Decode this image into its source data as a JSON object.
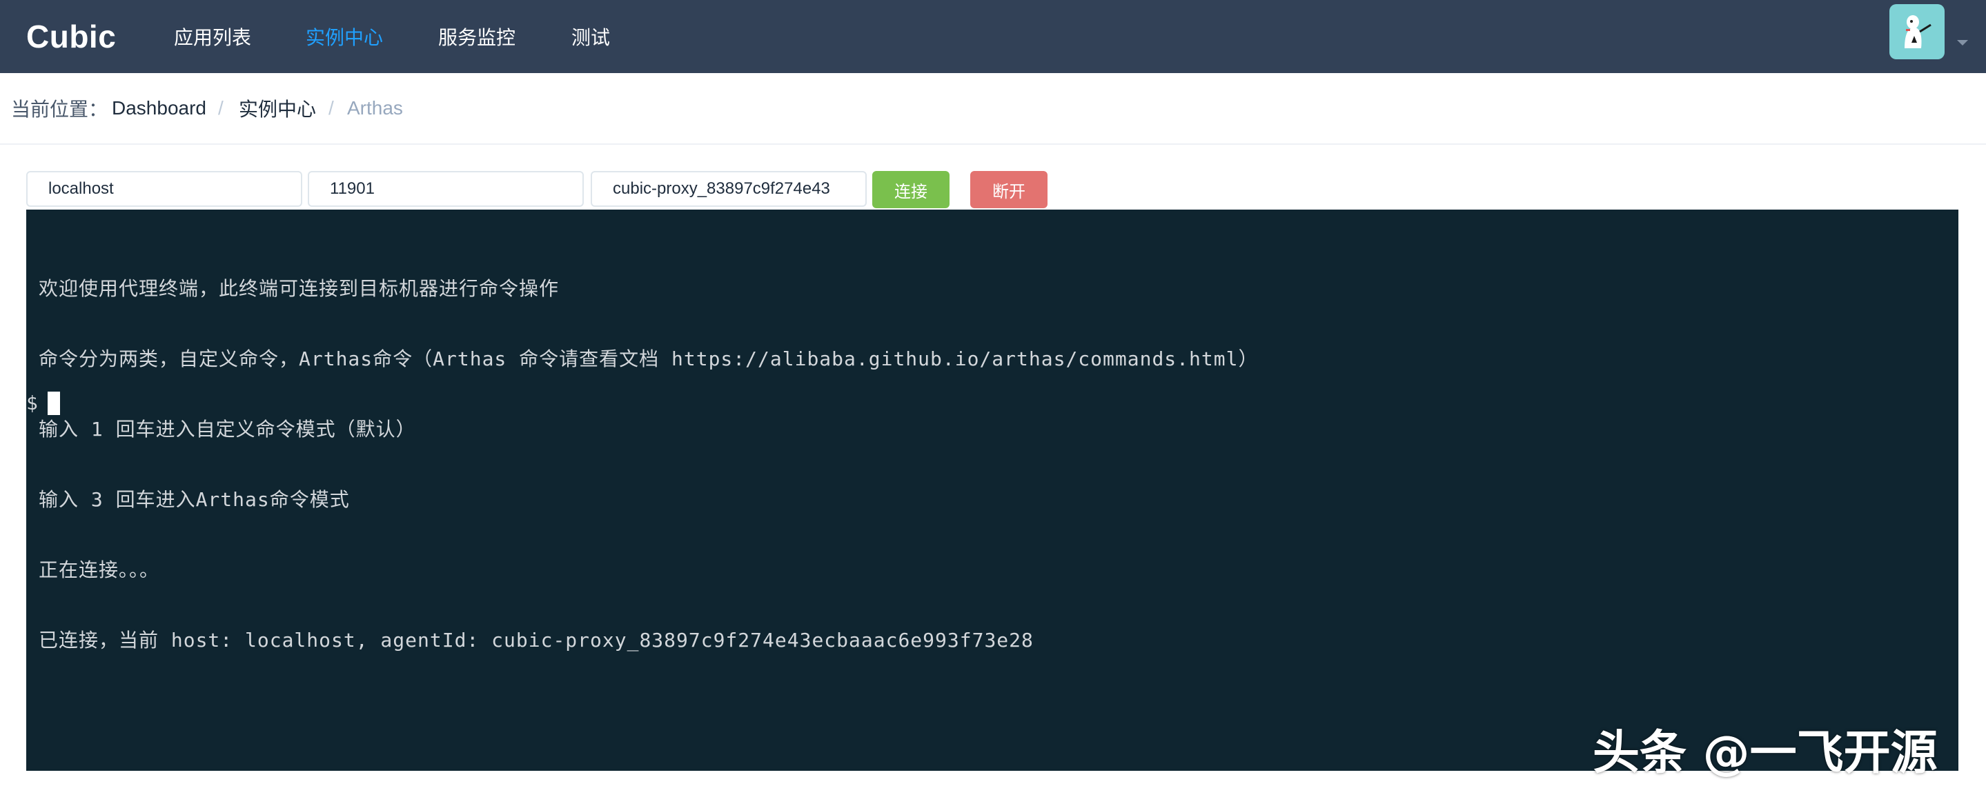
{
  "navbar": {
    "brand": "Cubic",
    "items": [
      {
        "label": "应用列表",
        "active": false
      },
      {
        "label": "实例中心",
        "active": true
      },
      {
        "label": "服务监控",
        "active": false
      },
      {
        "label": "测试",
        "active": false
      }
    ],
    "avatar_icon": "user-avatar-icon",
    "dropdown_icon": "caret-down-icon",
    "colors": {
      "background": "#324157",
      "active": "#20a0ff"
    }
  },
  "breadcrumb": {
    "prefix": "当前位置：",
    "items": [
      "Dashboard",
      "实例中心"
    ],
    "current": "Arthas",
    "separator": "/"
  },
  "connection": {
    "host_value": "localhost",
    "port_value": "11901",
    "agent_value": "cubic-proxy_83897c9f274e43",
    "connect_label": "连接",
    "disconnect_label": "断开",
    "colors": {
      "connect": "#7ac04d",
      "disconnect": "#e37370"
    }
  },
  "terminal": {
    "lines": [
      "欢迎使用代理终端，此终端可连接到目标机器进行命令操作",
      "命令分为两类，自定义命令，Arthas命令（Arthas 命令请查看文档 https://alibaba.github.io/arthas/commands.html）",
      "输入 1 回车进入自定义命令模式（默认）",
      "输入 3 回车进入Arthas命令模式",
      "正在连接。。。",
      "已连接，当前 host: localhost, agentId: cubic-proxy_83897c9f274e43ecbaaac6e993f73e28"
    ],
    "prompt": "$",
    "background": "#0f2530"
  },
  "watermark": "头条 @一飞开源"
}
